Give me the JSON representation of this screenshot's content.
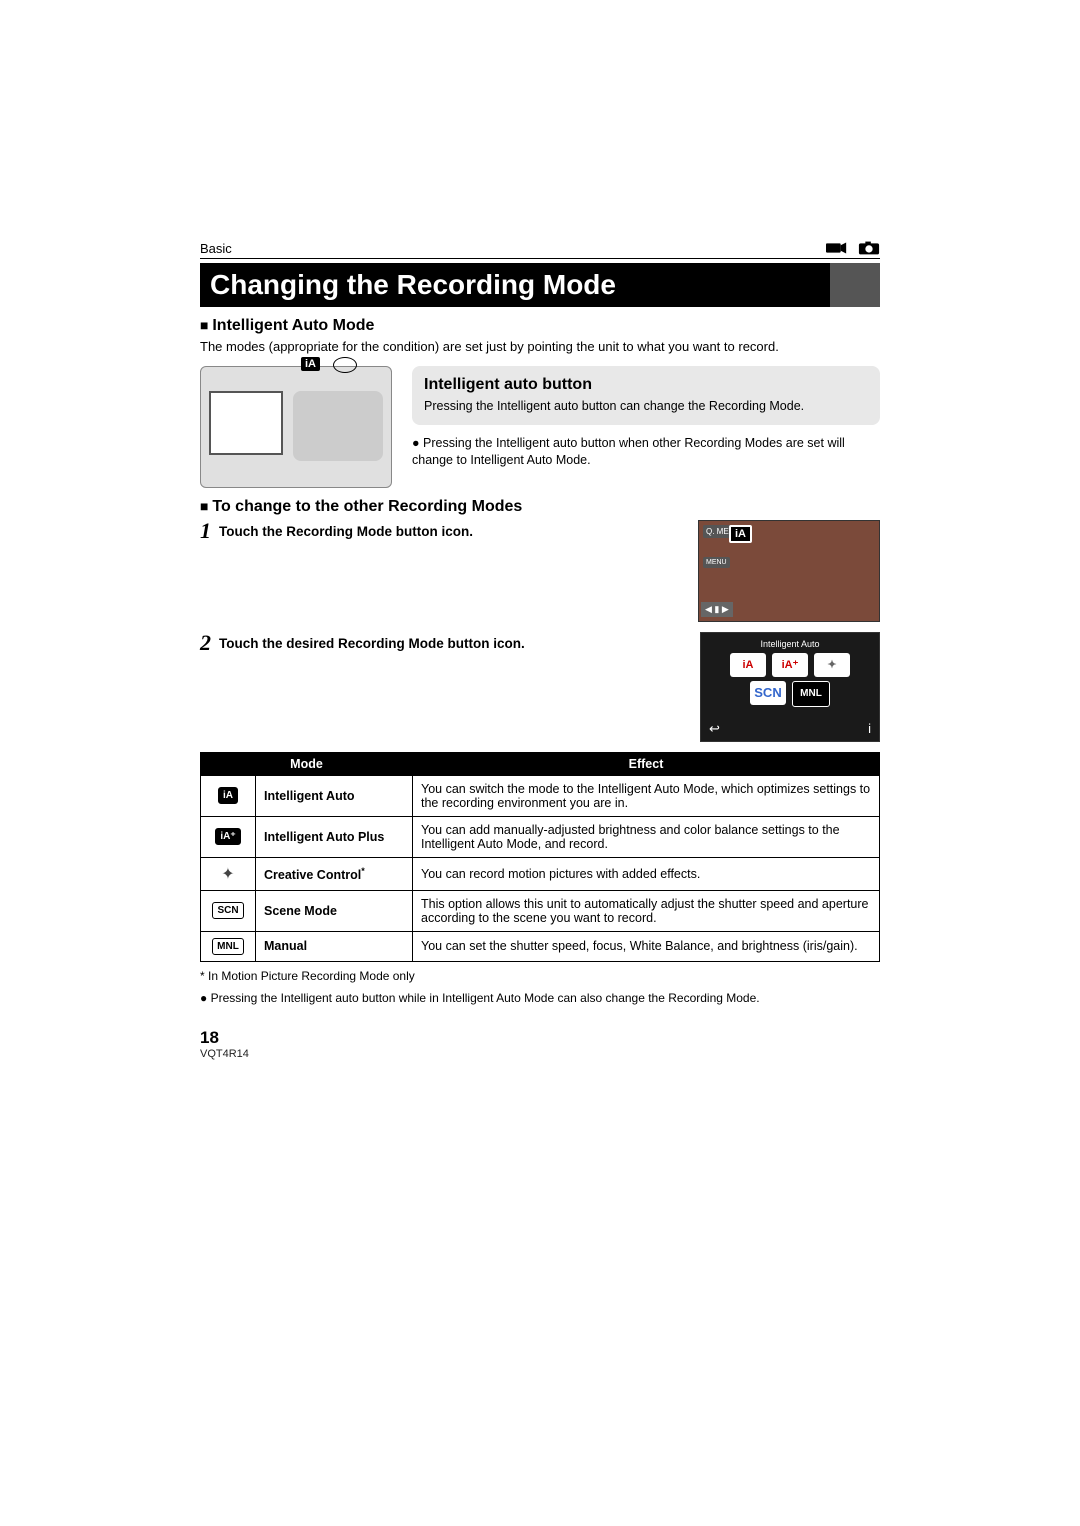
{
  "breadcrumb": "Basic",
  "title": "Changing the Recording Mode",
  "section1": {
    "heading": "Intelligent Auto Mode",
    "text": "The modes (appropriate for the condition) are set just by pointing the unit to what you want to record."
  },
  "callout": {
    "title": "Intelligent auto button",
    "text": "Pressing the Intelligent auto button can change the Recording Mode."
  },
  "bullet1": "Pressing the Intelligent auto button when other Recording Modes are set will change to Intelligent Auto Mode.",
  "section2": {
    "heading": "To change to the other Recording Modes"
  },
  "steps": [
    {
      "num": "1",
      "text": "Touch the Recording Mode button icon."
    },
    {
      "num": "2",
      "text": "Touch the desired Recording Mode button icon."
    }
  ],
  "screenshot1": {
    "menu1": "Q.\nMENU",
    "ia": "iA",
    "menu2": "MENU",
    "arrows": "◀ ▮ ▶"
  },
  "screenshot2": {
    "title": "Intelligent Auto",
    "btn_ia": "iA",
    "btn_iaplus": "iA⁺",
    "btn_creative": "✦",
    "btn_scn": "SCN",
    "btn_mnl": "MNL",
    "back": "↩",
    "info": "i"
  },
  "table": {
    "head_mode": "Mode",
    "head_effect": "Effect",
    "rows": [
      {
        "icon": "iA",
        "icon_class": "icon-badge",
        "name": "Intelligent Auto",
        "effect": "You can switch the mode to the Intelligent Auto Mode, which optimizes settings to the recording environment you are in."
      },
      {
        "icon": "iA⁺",
        "icon_class": "icon-badge",
        "name": "Intelligent Auto Plus",
        "effect": "You can add manually-adjusted brightness and color balance settings to the Intelligent Auto Mode, and record."
      },
      {
        "icon": "✦",
        "icon_class": "icon-creative",
        "name": "Creative Control",
        "name_sup": "*",
        "effect": "You can record motion pictures with added effects."
      },
      {
        "icon": "SCN",
        "icon_class": "icon-badge icon-scn",
        "name": "Scene Mode",
        "effect": "This option allows this unit to automatically adjust the shutter speed and aperture according to the scene you want to record."
      },
      {
        "icon": "MNL",
        "icon_class": "icon-badge icon-mnl",
        "name": "Manual",
        "effect": "You can set the shutter speed, focus, White Balance, and brightness (iris/gain)."
      }
    ]
  },
  "footnotes": {
    "star": "* In Motion Picture Recording Mode only",
    "bullet": "Pressing the Intelligent auto button while in Intelligent Auto Mode can also change the Recording Mode."
  },
  "footer": {
    "page": "18",
    "doc_id": "VQT4R14"
  }
}
